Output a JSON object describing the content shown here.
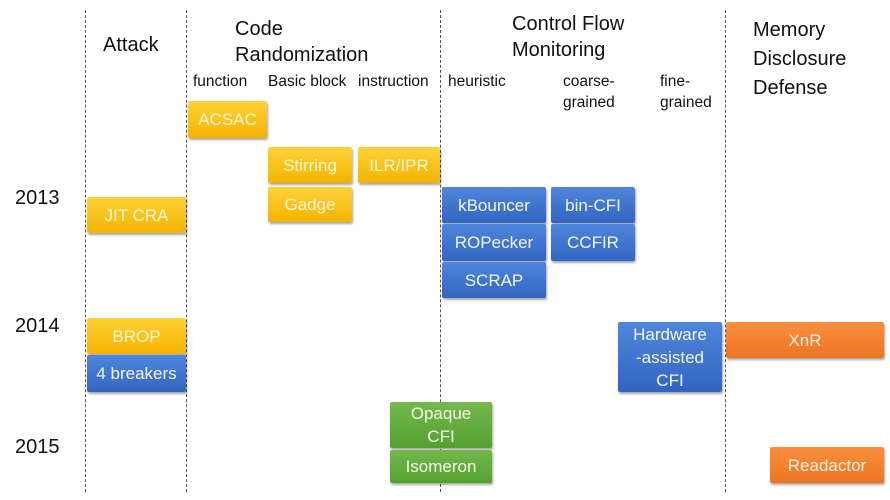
{
  "colors": {
    "attack_randomization": "#f4b400",
    "control_flow": "#3a6fc9",
    "hybrid": "#5fa83a",
    "memory_disclosure": "#f07a28"
  },
  "columns": {
    "attack": "Attack",
    "code_randomization": [
      "Code",
      "Randomization"
    ],
    "code_randomization_sub": {
      "function": "function",
      "basic_block": "Basic block",
      "instruction": "instruction"
    },
    "control_flow": [
      "Control Flow",
      "Monitoring"
    ],
    "control_flow_sub": {
      "heuristic": "heuristic",
      "coarse": [
        "coarse-",
        "grained"
      ],
      "fine": [
        "fine-",
        "grained"
      ]
    },
    "memory_disclosure": [
      "Memory",
      "Disclosure",
      "Defense"
    ]
  },
  "years": [
    "2013",
    "2014",
    "2015"
  ],
  "boxes": {
    "acsac": "ACSAC",
    "stirring": "Stirring",
    "ilr": "ILR/IPR",
    "gadge": "Gadge",
    "jitcra": "JIT CRA",
    "kbouncer": "kBouncer",
    "bincfi": "bin-CFI",
    "ropecker": "ROPecker",
    "ccfir": "CCFIR",
    "scrap": "SCRAP",
    "brop": "BROP",
    "breakers": "4 breakers",
    "hwcfi": [
      "Hardware",
      "-assisted",
      "CFI"
    ],
    "xnr": "XnR",
    "opaque": [
      "Opaque",
      "CFI"
    ],
    "isomeron": "Isomeron",
    "readactor": "Readactor"
  }
}
